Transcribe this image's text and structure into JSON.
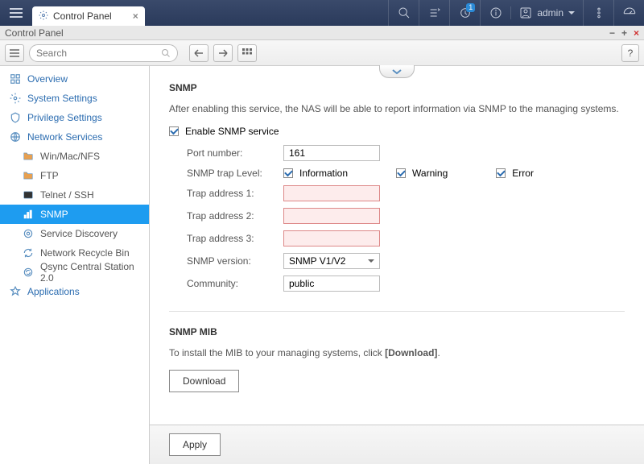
{
  "topbar": {
    "tab_label": "Control Panel",
    "user_name": "admin",
    "notif_badge": "1"
  },
  "window": {
    "title": "Control Panel",
    "search_placeholder": "Search"
  },
  "sidebar": {
    "items": [
      {
        "label": "Overview"
      },
      {
        "label": "System Settings"
      },
      {
        "label": "Privilege Settings"
      },
      {
        "label": "Network Services"
      },
      {
        "label": "Win/Mac/NFS"
      },
      {
        "label": "FTP"
      },
      {
        "label": "Telnet / SSH"
      },
      {
        "label": "SNMP"
      },
      {
        "label": "Service Discovery"
      },
      {
        "label": "Network Recycle Bin"
      },
      {
        "label": "Qsync Central Station 2.0"
      },
      {
        "label": "Applications"
      }
    ]
  },
  "snmp": {
    "title": "SNMP",
    "description": "After enabling this service, the NAS will be able to report information via SNMP to the managing systems.",
    "enable_label": "Enable SNMP service",
    "port_label": "Port number:",
    "port_value": "161",
    "trap_level_label": "SNMP trap Level:",
    "level_info": "Information",
    "level_warn": "Warning",
    "level_error": "Error",
    "trap1_label": "Trap address 1:",
    "trap1_value": "",
    "trap2_label": "Trap address 2:",
    "trap2_value": "",
    "trap3_label": "Trap address 3:",
    "trap3_value": "",
    "version_label": "SNMP version:",
    "version_value": "SNMP V1/V2",
    "community_label": "Community:",
    "community_value": "public"
  },
  "mib": {
    "title": "SNMP MIB",
    "desc_prefix": "To install the MIB to your managing systems, click ",
    "desc_link": "[Download]",
    "desc_suffix": ".",
    "download_label": "Download"
  },
  "footer": {
    "apply_label": "Apply"
  }
}
